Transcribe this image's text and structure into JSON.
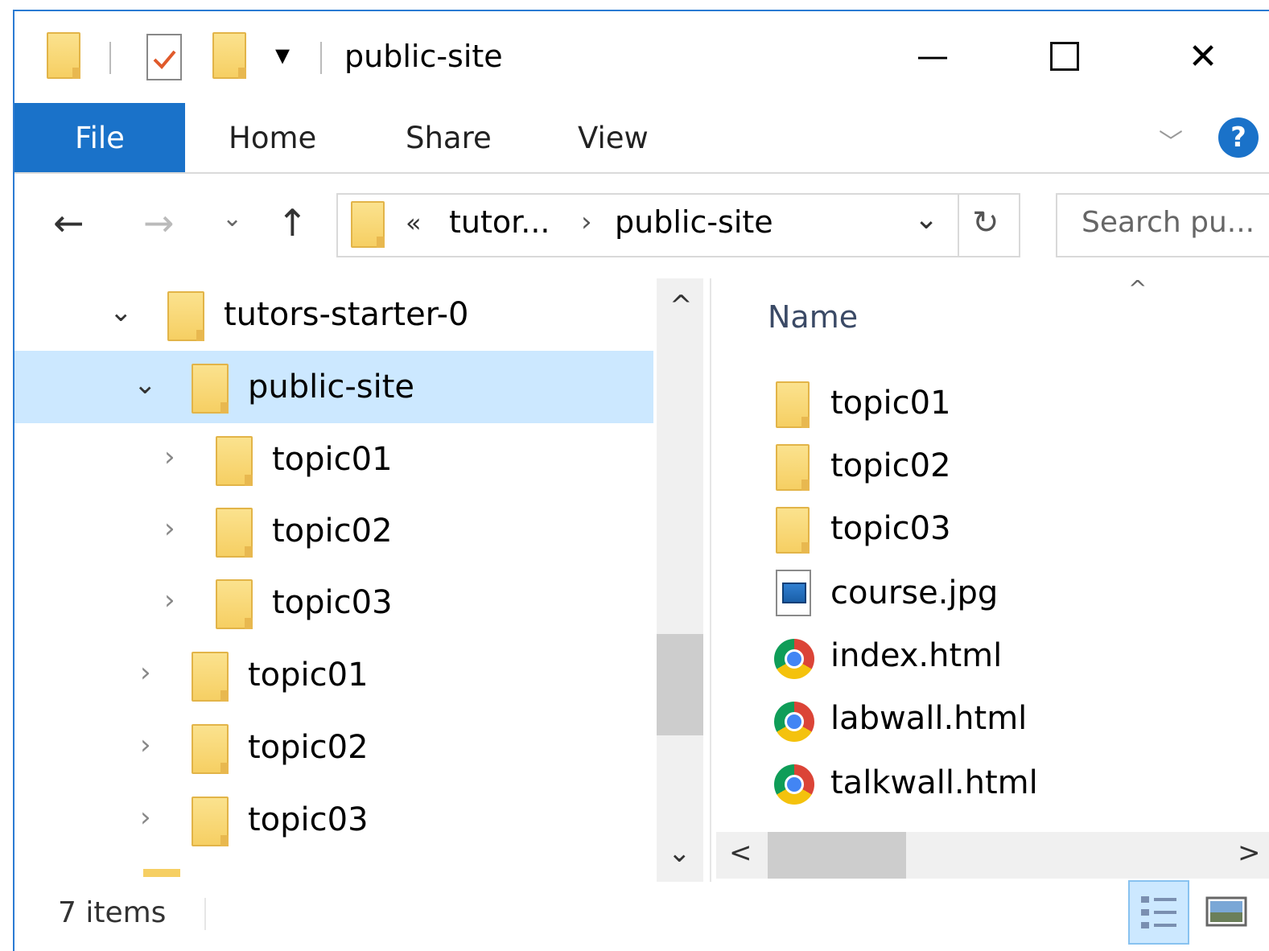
{
  "window": {
    "title": "public-site",
    "qat_dropdown_glyph": "▾",
    "minimize_glyph": "—",
    "maximize_glyph": "☐",
    "close_glyph": "✕"
  },
  "ribbon": {
    "tabs": [
      "File",
      "Home",
      "Share",
      "View"
    ],
    "collapse_glyph": "﹀",
    "help_glyph": "?"
  },
  "nav": {
    "back_glyph": "←",
    "forward_glyph": "→",
    "recent_glyph": "⌄",
    "up_glyph": "↑",
    "breadcrumb": {
      "overflow": "«",
      "parent": "tutor...",
      "separator": "›",
      "current": "public-site"
    },
    "dropdown_glyph": "⌄",
    "refresh_glyph": "↻",
    "search_placeholder": "Search pu..."
  },
  "tree": {
    "items": [
      {
        "label": "tutors-starter-0",
        "chevron": "⌄",
        "level": 0
      },
      {
        "label": "public-site",
        "chevron": "⌄",
        "level": 1,
        "selected": true
      },
      {
        "label": "topic01",
        "chevron": "›",
        "level": 2
      },
      {
        "label": "topic02",
        "chevron": "›",
        "level": 2
      },
      {
        "label": "topic03",
        "chevron": "›",
        "level": 2
      },
      {
        "label": "topic01",
        "chevron": "›",
        "level": 1
      },
      {
        "label": "topic02",
        "chevron": "›",
        "level": 1
      },
      {
        "label": "topic03",
        "chevron": "›",
        "level": 1
      }
    ],
    "scroll_up": "^",
    "scroll_down": "⌄"
  },
  "files": {
    "column_name": "Name",
    "sort_indicator": "^",
    "items": [
      {
        "name": "topic01",
        "icon": "folder-icon"
      },
      {
        "name": "topic02",
        "icon": "folder-icon"
      },
      {
        "name": "topic03",
        "icon": "folder-icon"
      },
      {
        "name": "course.jpg",
        "icon": "image-file-icon"
      },
      {
        "name": "index.html",
        "icon": "chrome-html-icon"
      },
      {
        "name": "labwall.html",
        "icon": "chrome-html-icon"
      },
      {
        "name": "talkwall.html",
        "icon": "chrome-html-icon"
      }
    ],
    "scroll_left": "<",
    "scroll_right": ">"
  },
  "status": {
    "item_count": "7 items"
  },
  "colors": {
    "accent": "#1a72c9",
    "selection": "#cce8ff",
    "folder": "#f6cf63"
  }
}
